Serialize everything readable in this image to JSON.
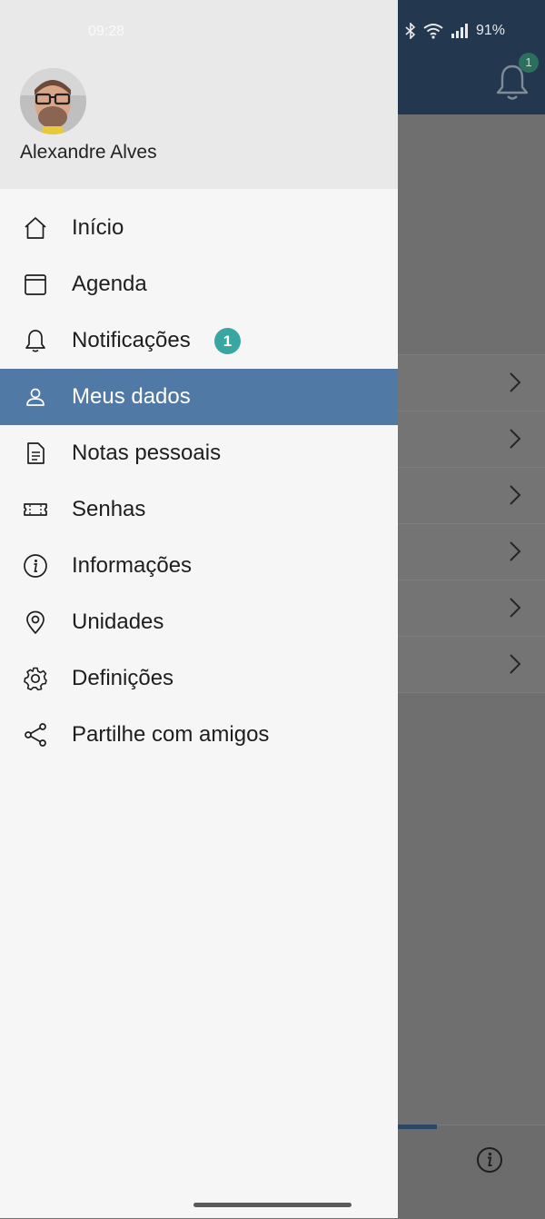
{
  "status_bar": {
    "time": "09:28",
    "battery": "91%"
  },
  "app": {
    "notification_count": "1",
    "list_rows": 6
  },
  "drawer": {
    "user_name": "Alexandre Alves",
    "menu": [
      {
        "label": "Início",
        "icon": "home-icon"
      },
      {
        "label": "Agenda",
        "icon": "calendar-icon"
      },
      {
        "label": "Notificações",
        "icon": "bell-icon",
        "badge": "1"
      },
      {
        "label": "Meus dados",
        "icon": "person-icon",
        "active": true
      },
      {
        "label": "Notas pessoais",
        "icon": "document-icon"
      },
      {
        "label": "Senhas",
        "icon": "ticket-icon"
      },
      {
        "label": "Informações",
        "icon": "info-icon"
      },
      {
        "label": "Unidades",
        "icon": "location-pin-icon"
      },
      {
        "label": "Definições",
        "icon": "gear-icon"
      },
      {
        "label": "Partilhe com amigos",
        "icon": "share-icon"
      }
    ]
  },
  "colors": {
    "active_item": "#5079a5",
    "badge": "#3aa6a2",
    "app_header": "#23384f"
  }
}
